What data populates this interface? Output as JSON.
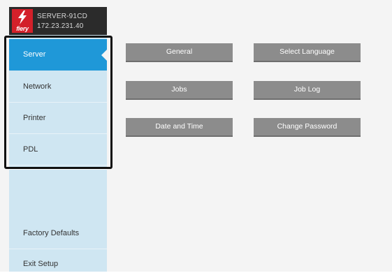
{
  "header": {
    "logo_text": "fiery",
    "server_name": "SERVER-91CD",
    "server_ip": "172.23.231.40"
  },
  "sidebar": {
    "items": [
      {
        "label": "Server"
      },
      {
        "label": "Network"
      },
      {
        "label": "Printer"
      },
      {
        "label": "PDL"
      },
      {
        "label": "Factory Defaults"
      },
      {
        "label": "Exit Setup"
      }
    ],
    "active_index": 0
  },
  "main": {
    "buttons": [
      {
        "label": "General"
      },
      {
        "label": "Select Language"
      },
      {
        "label": "Jobs"
      },
      {
        "label": "Job Log"
      },
      {
        "label": "Date and Time"
      },
      {
        "label": "Change Password"
      }
    ]
  },
  "colors": {
    "accent": "#1f98d8",
    "sidebar_bg": "#cfe6f2",
    "button_bg": "#8c8c8c",
    "brand_red": "#d3202a"
  }
}
